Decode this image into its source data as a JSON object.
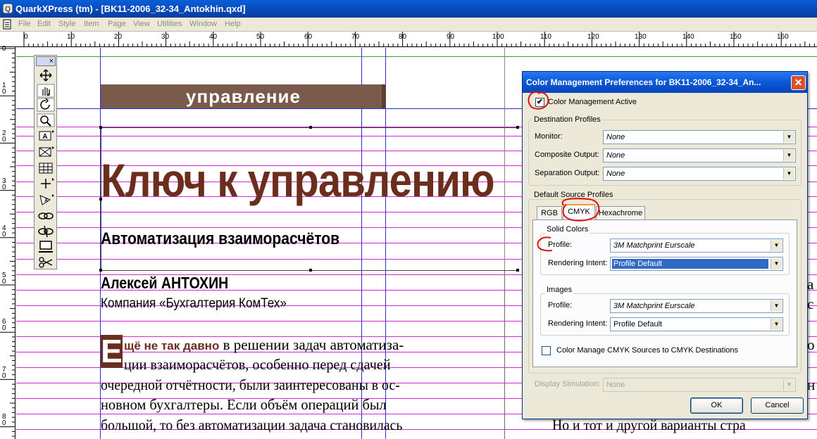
{
  "app": {
    "window_title": "QuarkXPress (tm) - [BK11-2006_32-34_Antokhin.qxd]"
  },
  "menu": [
    "File",
    "Edit",
    "Style",
    "Item",
    "Page",
    "View",
    "Utilities",
    "Window",
    "Help"
  ],
  "ruler": {
    "top_labels": [
      "0",
      "10",
      "20",
      "30",
      "40",
      "50",
      "60",
      "70",
      "80",
      "90",
      "100",
      "110",
      "120",
      "130",
      "140",
      "150",
      "160"
    ],
    "left_labels": [
      "0",
      "1\n0",
      "2\n0",
      "3\n0",
      "4\n0",
      "5\n0",
      "6\n0",
      "7\n0",
      "8\n0"
    ]
  },
  "toolbox": {
    "close_label": "×",
    "tools": [
      "item-tool",
      "content-tool",
      "rotation-tool",
      "zoom-tool",
      "text-box-tool",
      "picture-box-tool",
      "table-tool",
      "line-tool",
      "text-path-tool",
      "linking-tool",
      "unlinking-tool",
      "scissors-frame-tool",
      "scissors-tool"
    ]
  },
  "document": {
    "section_banner": "управление",
    "headline": "Ключ к управлению",
    "subtitle": "Автоматизация взаиморасчётов",
    "author": "Алексей АНТОХИН",
    "company": "Компания «Бухгалтерия КомТех»",
    "drop_cap": "Е",
    "lead_in": "щё не так давно",
    "body_lines": [
      " в решении задач автоматиза-",
      "ции взаиморасчётов, особенно перед сдачей",
      "очередной отчётности, были заинтересованы в ос-",
      "новном бухгалтеры. Если объём операций был",
      "большой, то без автоматизации задача становилась"
    ],
    "right_column_fragments": [
      "а",
      "с",
      "о",
      "н"
    ],
    "right_column_bottom": "Но и тот и другой варианты стра"
  },
  "dialog": {
    "title": "Color Management Preferences for BK11-2006_32-34_An...",
    "close_label": "✕",
    "color_management_active": {
      "label": "Color Management Active",
      "checked": true
    },
    "destination_profiles": {
      "label": "Destination Profiles",
      "monitor": {
        "label": "Monitor:",
        "value": "None"
      },
      "composite": {
        "label": "Composite Output:",
        "value": "None"
      },
      "separation": {
        "label": "Separation Output:",
        "value": "None"
      }
    },
    "default_source": {
      "label": "Default Source Profiles",
      "tabs": [
        "RGB",
        "CMYK",
        "Hexachrome"
      ],
      "active_tab": "CMYK",
      "solid_colors": {
        "label": "Solid Colors",
        "profile_label": "Profile:",
        "profile_value": "3M Matchprint Eurscale",
        "intent_label": "Rendering Intent:",
        "intent_value": "Profile Default"
      },
      "images": {
        "label": "Images",
        "profile_label": "Profile:",
        "profile_value": "3M Matchprint Eurscale",
        "intent_label": "Rendering Intent:",
        "intent_value": "Profile Default"
      },
      "cmyk_to_cmyk": {
        "label": "Color Manage CMYK Sources to CMYK Destinations",
        "checked": false
      }
    },
    "display_simulation": {
      "label": "Display Simulation:",
      "value": "None"
    },
    "ok_label": "OK",
    "cancel_label": "Cancel",
    "dropdown_arrow": "▼"
  },
  "colors": {
    "headline": "#6b2e1c",
    "banner": "#7a5a4a",
    "guide_vertical": "#3232c8",
    "guide_horizontal": "#d22ad2",
    "annotation": "#e01010"
  }
}
